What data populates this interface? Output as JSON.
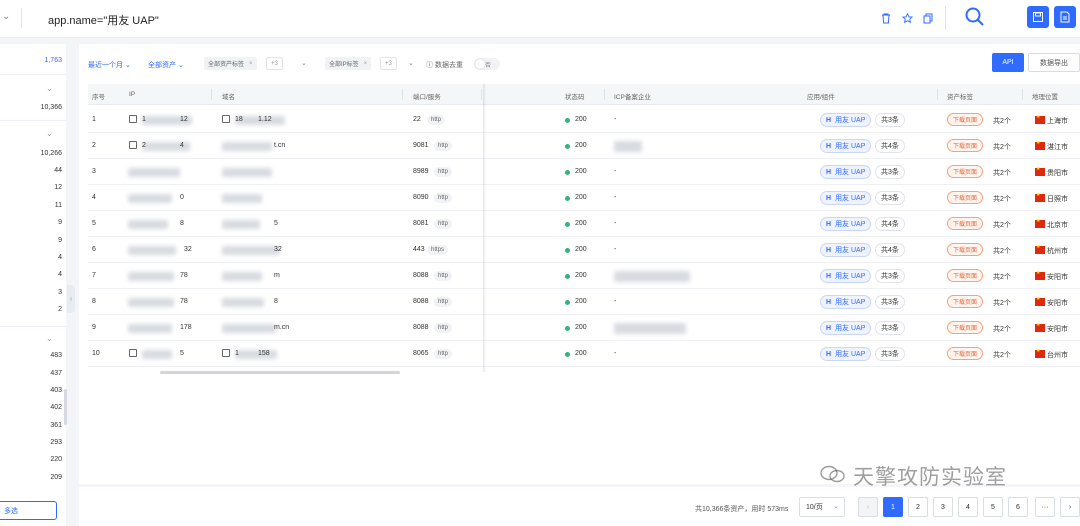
{
  "topbar": {
    "query": "app.name=\"用友 UAP\""
  },
  "sidebar": {
    "counts": [
      "1,763",
      "10,366",
      "10,266",
      "44",
      "12",
      "11",
      "9",
      "9",
      "4",
      "4",
      "3",
      "2",
      "483",
      "437",
      "403",
      "402",
      "361",
      "293",
      "220",
      "209"
    ],
    "multi_select_label": "多选"
  },
  "filters": {
    "time": "最近一个月",
    "assets": "全部资产",
    "asset_tag_chip": "全部资产标签",
    "asset_tag_more": "+3",
    "ip_tag_chip": "全部IP标签",
    "ip_tag_more": "+3",
    "dedupe_label": "数据去重",
    "dedupe_toggle": "否",
    "api_button": "API",
    "export_button": "数据导出"
  },
  "table": {
    "headers": [
      "序号",
      "IP",
      "域名",
      "端口/服务",
      "状态码",
      "ICP备案企业",
      "应用/组件",
      "资产标签",
      "地理位置"
    ],
    "rows": [
      {
        "no": "1",
        "ip": "1",
        "ip_tail": "12",
        "domain": "18",
        "domain_tail": "1.12",
        "port": "22",
        "service": "http",
        "status": "200",
        "icp": "-",
        "app": "用友 UAP",
        "app_count": "共3条",
        "tag": "下载页面",
        "tag_count": "共2个",
        "city": "上海市"
      },
      {
        "no": "2",
        "ip": "2",
        "ip_tail": "4",
        "domain": "",
        "domain_tail": "t.cn",
        "port": "9081",
        "service": "http",
        "status": "200",
        "icp": "",
        "app": "用友 UAP",
        "app_count": "共4条",
        "tag": "下载页面",
        "tag_count": "共2个",
        "city": "湛江市"
      },
      {
        "no": "3",
        "ip": "",
        "ip_tail": "",
        "domain": "",
        "domain_tail": "",
        "port": "8989",
        "service": "http",
        "status": "200",
        "icp": "-",
        "app": "用友 UAP",
        "app_count": "共3条",
        "tag": "下载页面",
        "tag_count": "共2个",
        "city": "贵阳市"
      },
      {
        "no": "4",
        "ip": "",
        "ip_tail": "0",
        "domain": "",
        "domain_tail": "",
        "port": "8090",
        "service": "http",
        "status": "200",
        "icp": "-",
        "app": "用友 UAP",
        "app_count": "共3条",
        "tag": "下载页面",
        "tag_count": "共2个",
        "city": "日照市"
      },
      {
        "no": "5",
        "ip": "",
        "ip_tail": "8",
        "domain": "",
        "domain_tail": "5",
        "port": "8081",
        "service": "http",
        "status": "200",
        "icp": "-",
        "app": "用友 UAP",
        "app_count": "共4条",
        "tag": "下载页面",
        "tag_count": "共2个",
        "city": "北京市"
      },
      {
        "no": "6",
        "ip": "",
        "ip_tail": "32",
        "domain": "",
        "domain_tail": "32",
        "port": "443",
        "service": "https",
        "status": "200",
        "icp": "-",
        "app": "用友 UAP",
        "app_count": "共4条",
        "tag": "下载页面",
        "tag_count": "共2个",
        "city": "杭州市"
      },
      {
        "no": "7",
        "ip": "",
        "ip_tail": "78",
        "domain": "",
        "domain_tail": "m",
        "port": "8088",
        "service": "http",
        "status": "200",
        "icp": "",
        "app": "用友 UAP",
        "app_count": "共3条",
        "tag": "下载页面",
        "tag_count": "共2个",
        "city": "安阳市"
      },
      {
        "no": "8",
        "ip": "",
        "ip_tail": "78",
        "domain": "",
        "domain_tail": "8",
        "port": "8088",
        "service": "http",
        "status": "200",
        "icp": "-",
        "app": "用友 UAP",
        "app_count": "共3条",
        "tag": "下载页面",
        "tag_count": "共2个",
        "city": "安阳市"
      },
      {
        "no": "9",
        "ip": "",
        "ip_tail": "178",
        "domain": "",
        "domain_tail": "m.cn",
        "port": "8088",
        "service": "http",
        "status": "200",
        "icp": "",
        "app": "用友 UAP",
        "app_count": "共3条",
        "tag": "下载页面",
        "tag_count": "共2个",
        "city": "安阳市"
      },
      {
        "no": "10",
        "ip": "",
        "ip_tail": "5",
        "domain": "1",
        "domain_tail": "158",
        "port": "8065",
        "service": "http",
        "status": "200",
        "icp": "-",
        "app": "用友 UAP",
        "app_count": "共3条",
        "tag": "下载页面",
        "tag_count": "共2个",
        "city": "台州市"
      }
    ]
  },
  "pagination": {
    "total": "共10,366条资产，用时 573ms",
    "per_page": "10/页",
    "pages": [
      "1",
      "2",
      "3",
      "4",
      "5",
      "6"
    ],
    "ellipsis": "···",
    "current": "1"
  },
  "watermark": "天擎攻防实验室",
  "colors": {
    "accent": "#2f6bff",
    "status_ok": "#35b37e",
    "tag_red": "#e8663a"
  }
}
